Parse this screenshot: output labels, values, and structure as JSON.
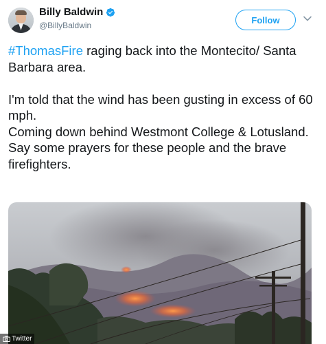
{
  "user": {
    "name": "Billy Baldwin",
    "handle": "@BillyBaldwin",
    "verified": true
  },
  "follow_button": {
    "label": "Follow"
  },
  "colors": {
    "accent": "#1da1f2",
    "text": "#14171a",
    "secondary_text": "#657786"
  },
  "tweet": {
    "hashtag": "#ThomasFire",
    "line1_rest": " raging back into the Montecito/ Santa Barbara area.",
    "line2": "I'm told that the wind has been gusting in excess of 60 mph.",
    "line3": "Coming down behind Westmont College & Lotusland.",
    "line4": "Say some prayers for these people and the brave firefighters."
  },
  "media": {
    "credit": "Twitter"
  },
  "icons": {
    "verified": "verified-badge-icon",
    "menu": "chevron-down-icon",
    "camera": "camera-icon"
  }
}
